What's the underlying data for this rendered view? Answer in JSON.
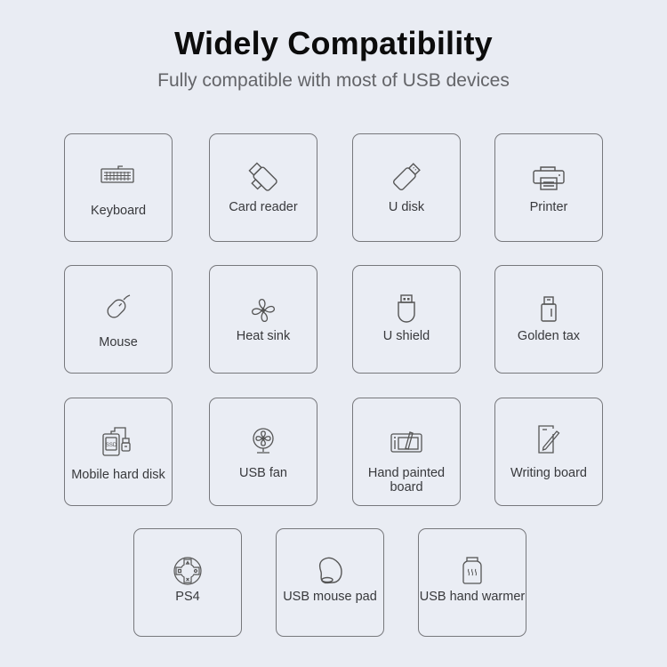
{
  "header": {
    "title": "Widely Compatibility",
    "subtitle": "Fully compatible with most of USB devices"
  },
  "devices": [
    {
      "label": "Keyboard",
      "icon": "keyboard-icon"
    },
    {
      "label": "Card reader",
      "icon": "card-reader-icon"
    },
    {
      "label": "U disk",
      "icon": "usb-drive-icon"
    },
    {
      "label": "Printer",
      "icon": "printer-icon"
    },
    {
      "label": "Mouse",
      "icon": "mouse-icon"
    },
    {
      "label": "Heat sink",
      "icon": "fan-blades-icon"
    },
    {
      "label": "U shield",
      "icon": "usb-key-icon"
    },
    {
      "label": "Golden tax",
      "icon": "usb-token-icon"
    },
    {
      "label": "Mobile hard disk",
      "icon": "ssd-drive-icon",
      "badge": "SSD"
    },
    {
      "label": "USB fan",
      "icon": "desk-fan-icon"
    },
    {
      "label": "Hand painted board",
      "icon": "drawing-tablet-icon"
    },
    {
      "label": "Writing board",
      "icon": "writing-tablet-icon"
    },
    {
      "label": "PS4",
      "icon": "gamepad-icon"
    },
    {
      "label": "USB mouse pad",
      "icon": "mouse-pad-icon"
    },
    {
      "label": "USB hand warmer",
      "icon": "hand-warmer-icon"
    }
  ]
}
